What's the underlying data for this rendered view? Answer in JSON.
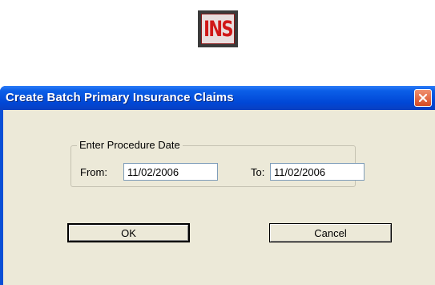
{
  "logo": {
    "text": "INS",
    "icon": "ins-logo-icon"
  },
  "dialog": {
    "title": "Create Batch Primary Insurance Claims",
    "close_icon": "close-icon",
    "group_label": "Enter Procedure Date",
    "from_label": "From:",
    "from_value": "11/02/2006",
    "to_label": "To:",
    "to_value": "11/02/2006",
    "ok_label": "OK",
    "cancel_label": "Cancel"
  },
  "colors": {
    "titlebar": "#0047d6",
    "client": "#ece9d8",
    "close": "#d64a22",
    "logo_text": "#d01818"
  }
}
